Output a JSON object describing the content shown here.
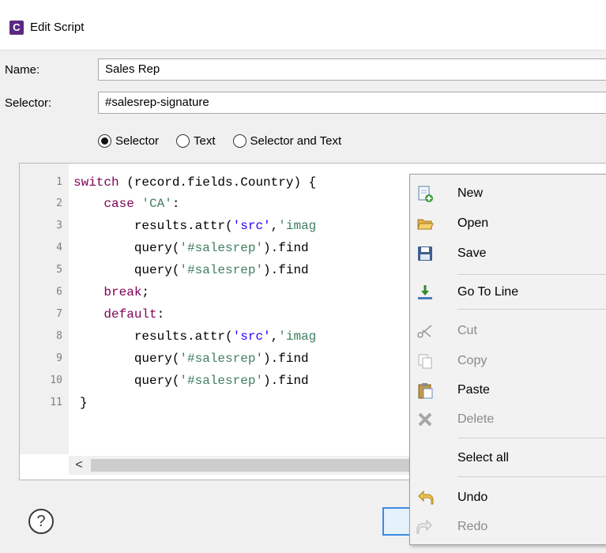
{
  "window": {
    "title": "Edit Script",
    "app_icon_letter": "C"
  },
  "form": {
    "name_label": "Name:",
    "name_value": "Sales Rep",
    "selector_label": "Selector:",
    "selector_value": "#salesrep-signature"
  },
  "radios": {
    "options": [
      "Selector",
      "Text",
      "Selector and Text"
    ],
    "selected": "Selector"
  },
  "editor": {
    "line_numbers": [
      "1",
      "2",
      "3",
      "4",
      "5",
      "6",
      "7",
      "8",
      "9",
      "10",
      "11"
    ],
    "lines": [
      [
        {
          "t": "switch",
          "c": "kw"
        },
        {
          "t": " (record.fields.Country) {"
        }
      ],
      [
        {
          "t": "    "
        },
        {
          "t": "case",
          "c": "kw"
        },
        {
          "t": " "
        },
        {
          "t": "'CA'",
          "c": "str2"
        },
        {
          "t": ":"
        }
      ],
      [
        {
          "t": "        results.attr("
        },
        {
          "t": "'src'",
          "c": "str"
        },
        {
          "t": ","
        },
        {
          "t": "'imag",
          "c": "str2"
        }
      ],
      [
        {
          "t": "        query("
        },
        {
          "t": "'#salesrep'",
          "c": "str2"
        },
        {
          "t": ").find"
        }
      ],
      [
        {
          "t": "        query("
        },
        {
          "t": "'#salesrep'",
          "c": "str2"
        },
        {
          "t": ").find"
        }
      ],
      [
        {
          "t": "    "
        },
        {
          "t": "break",
          "c": "kw"
        },
        {
          "t": ";"
        }
      ],
      [
        {
          "t": "    "
        },
        {
          "t": "default",
          "c": "kw"
        },
        {
          "t": ":"
        }
      ],
      [
        {
          "t": "        results.attr("
        },
        {
          "t": "'src'",
          "c": "str"
        },
        {
          "t": ","
        },
        {
          "t": "'imag",
          "c": "str2"
        }
      ],
      [
        {
          "t": "        query("
        },
        {
          "t": "'#salesrep'",
          "c": "str2"
        },
        {
          "t": ").find"
        }
      ],
      [
        {
          "t": "        query("
        },
        {
          "t": "'#salesrep'",
          "c": "str2"
        },
        {
          "t": ").find"
        }
      ],
      [
        {
          "t": "}"
        }
      ]
    ],
    "scroll_left_glyph": "<"
  },
  "help": {
    "glyph": "?"
  },
  "context_menu": {
    "items": [
      {
        "label": "New",
        "icon": "new-file-icon",
        "enabled": true
      },
      {
        "label": "Open",
        "icon": "open-folder-icon",
        "enabled": true
      },
      {
        "label": "Save",
        "icon": "save-disk-icon",
        "enabled": true
      },
      {
        "label": "Go To Line",
        "icon": "go-to-line-icon",
        "enabled": true
      },
      {
        "label": "Cut",
        "icon": "scissors-icon",
        "enabled": false
      },
      {
        "label": "Copy",
        "icon": "copy-icon",
        "enabled": false
      },
      {
        "label": "Paste",
        "icon": "paste-clipboard-icon",
        "enabled": true
      },
      {
        "label": "Delete",
        "icon": "delete-x-icon",
        "enabled": false
      },
      {
        "label": "Select all",
        "icon": "",
        "enabled": true
      },
      {
        "label": "Undo",
        "icon": "undo-arrow-icon",
        "enabled": true
      },
      {
        "label": "Redo",
        "icon": "redo-arrow-icon",
        "enabled": false
      }
    ]
  },
  "colors": {
    "keyword": "#7f0055",
    "string": "#2a00ff",
    "string_alt": "#3f7f5f",
    "app_icon": "#5a2a82",
    "focus_border": "#3c8be0"
  }
}
